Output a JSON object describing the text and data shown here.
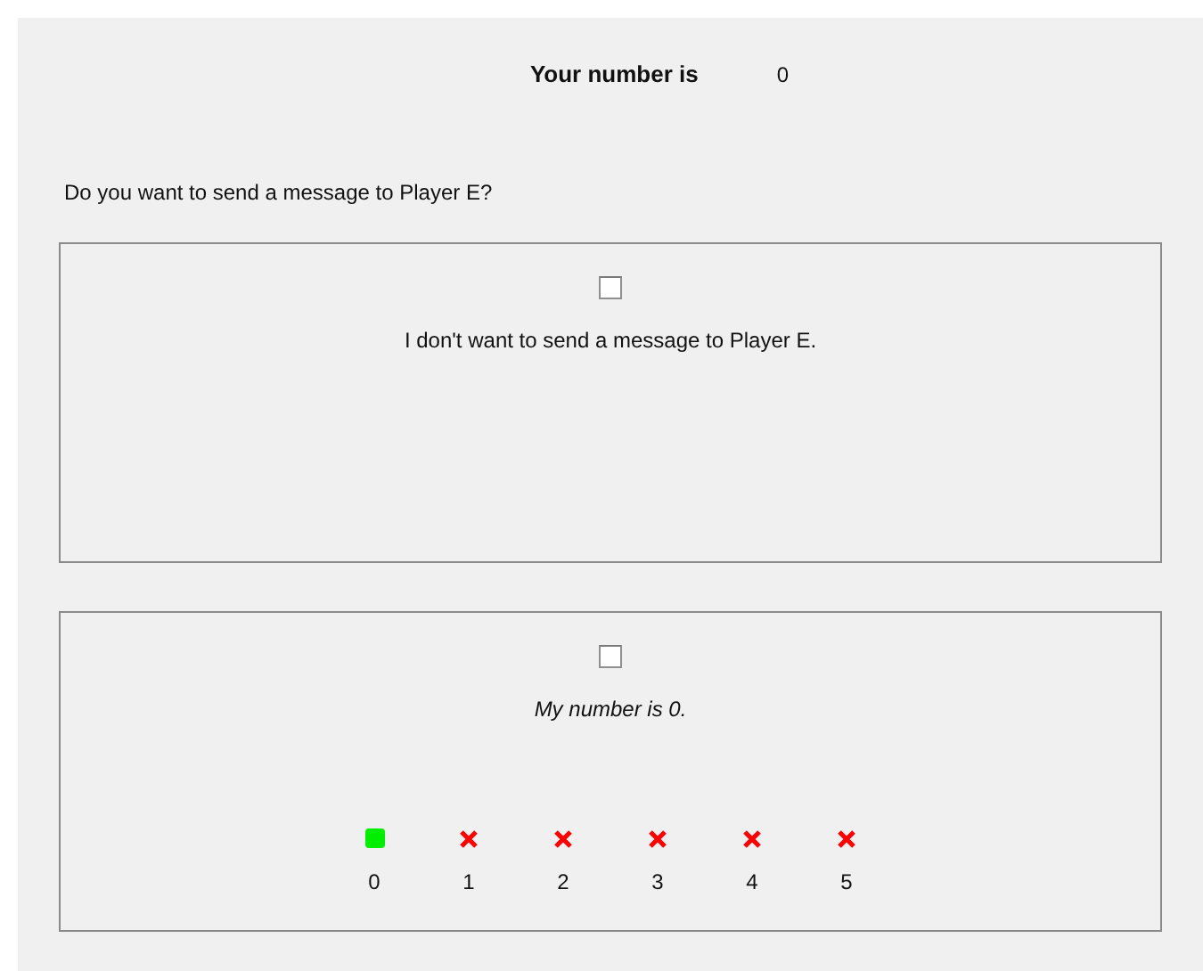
{
  "header": {
    "label": "Your number is",
    "value": "0"
  },
  "question": "Do you want to send a message to Player E?",
  "options": [
    {
      "checked": false,
      "text": "I don't want to send a message to Player E.",
      "italic": false
    },
    {
      "checked": false,
      "text": "My number is 0.",
      "italic": true,
      "numbers": [
        {
          "kind": "match",
          "label": "0"
        },
        {
          "kind": "miss",
          "label": "1"
        },
        {
          "kind": "miss",
          "label": "2"
        },
        {
          "kind": "miss",
          "label": "3"
        },
        {
          "kind": "miss",
          "label": "4"
        },
        {
          "kind": "miss",
          "label": "5"
        }
      ]
    }
  ]
}
